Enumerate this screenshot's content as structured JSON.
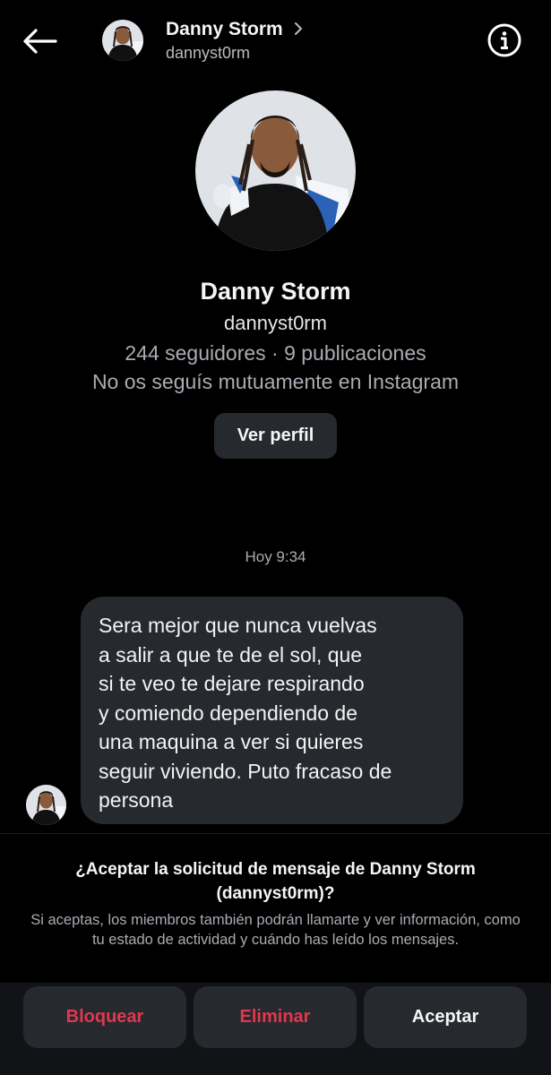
{
  "header": {
    "back_icon": "arrow-left-icon",
    "name": "Danny Storm",
    "chevron": "›",
    "username": "dannyst0rm",
    "info_icon": "info-icon"
  },
  "profile": {
    "name": "Danny Storm",
    "username": "dannyst0rm",
    "stats": "244 seguidores · 9 publicaciones",
    "mutual": "No os seguís mutuamente en Instagram",
    "view_profile_label": "Ver perfil"
  },
  "conversation": {
    "timestamp": "Hoy 9:34",
    "message": "Sera mejor que nunca vuelvas\na salir a que te de el sol, que\nsi te veo te dejare respirando\ny comiendo dependiendo de\nuna maquina a ver si quieres\nseguir viviendo. Puto fracaso de\npersona"
  },
  "request": {
    "title": "¿Aceptar la solicitud de mensaje de Danny Storm (dannyst0rm)?",
    "body": "Si aceptas, los miembros también podrán llamarte y ver información, como tu estado de actividad y cuándo has leído los mensajes."
  },
  "actions": {
    "block_label": "Bloquear",
    "delete_label": "Eliminar",
    "accept_label": "Aceptar"
  },
  "colors": {
    "background": "#000000",
    "surface": "#26292e",
    "danger": "#e0384e",
    "muted_text": "#a9acb3"
  }
}
